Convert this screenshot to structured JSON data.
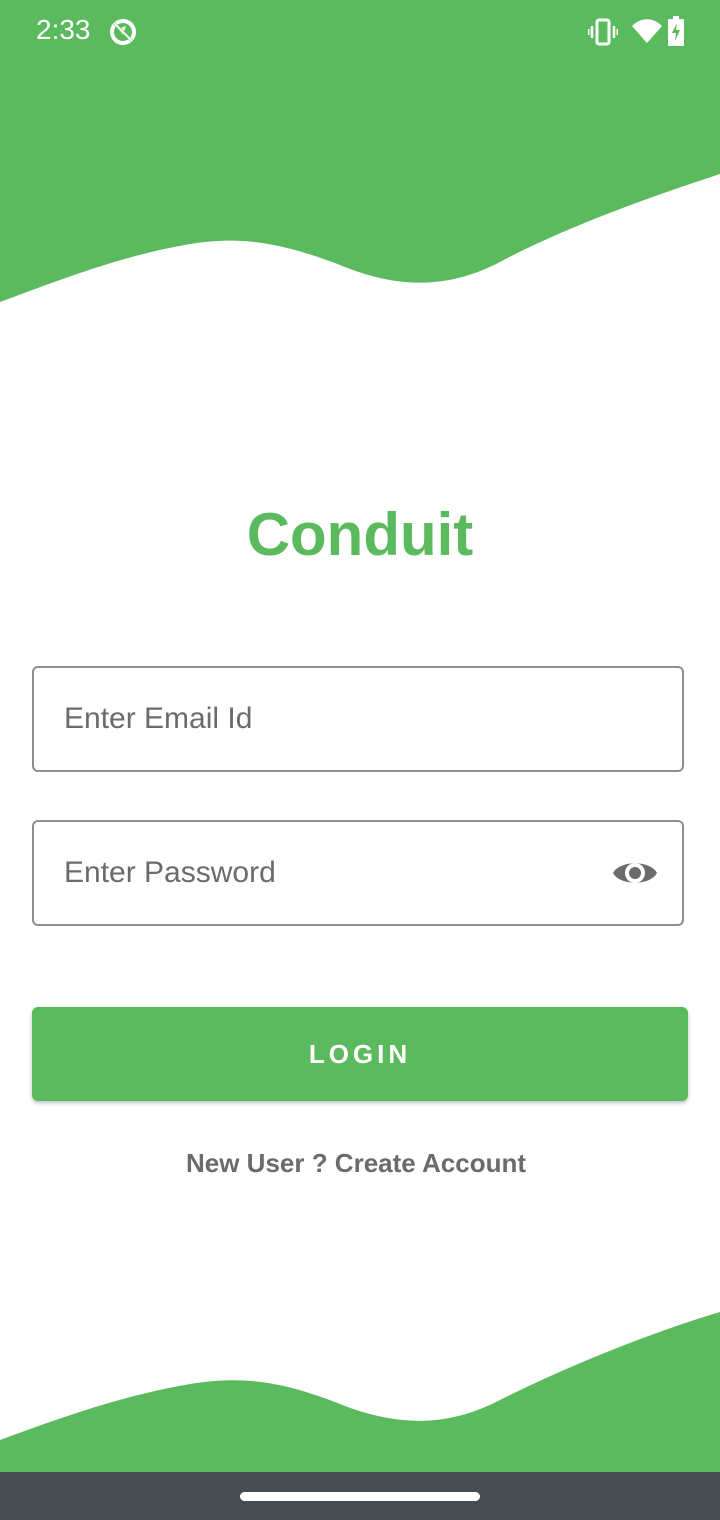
{
  "status_bar": {
    "time": "2:33",
    "icons": [
      "no-location-icon",
      "vibrate-icon",
      "wifi-icon",
      "battery-charging-icon"
    ]
  },
  "app": {
    "title": "Conduit",
    "accent_color": "#5cba5e"
  },
  "form": {
    "email": {
      "placeholder": "Enter Email Id",
      "value": ""
    },
    "password": {
      "placeholder": "Enter Password",
      "value": "",
      "toggle_icon": "eye-icon"
    },
    "login_label": "LOGIN",
    "create_account_label": "New User ? Create Account"
  },
  "nav_bar": {
    "color": "#464c52"
  }
}
